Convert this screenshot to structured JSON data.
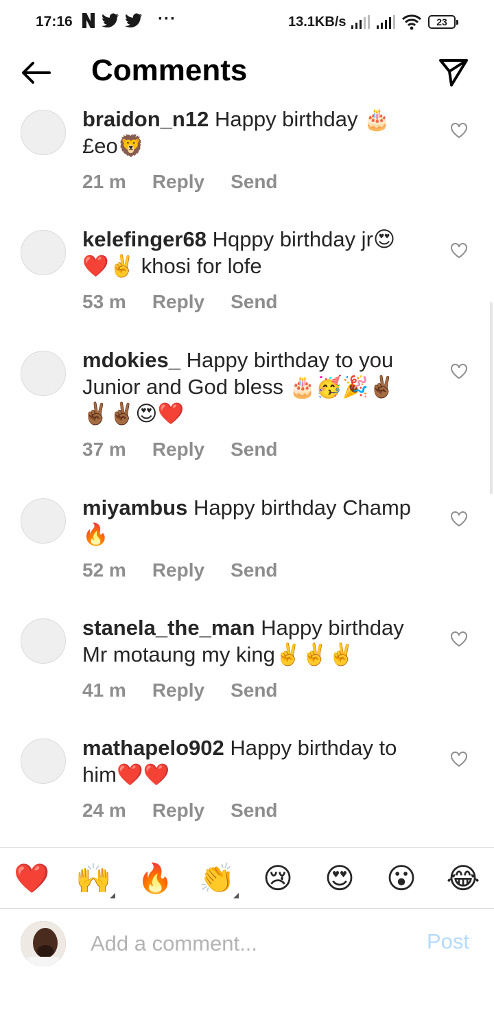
{
  "status_bar": {
    "time": "17:16",
    "more": "···",
    "net_speed": "13.1KB/s",
    "battery": "23"
  },
  "header": {
    "title": "Comments",
    "back_icon": "arrow-left-icon",
    "share_icon": "paper-plane-icon"
  },
  "comments": [
    {
      "username": "braidon_n12",
      "text": "Happy birthday 🎂 £eo🦁",
      "time": "21 m",
      "reply": "Reply",
      "send": "Send"
    },
    {
      "username": "kelefinger68",
      "text": "Hqppy birthday jr😍 ❤️✌️ khosi for lofe",
      "time": "53 m",
      "reply": "Reply",
      "send": "Send"
    },
    {
      "username": "mdokies_",
      "text": "Happy birthday to you Junior and God bless 🎂🥳🎉✌🏾 ✌🏾✌🏾😍❤️",
      "time": "37 m",
      "reply": "Reply",
      "send": "Send"
    },
    {
      "username": "miyambus",
      "text": "Happy birthday Champ 🔥",
      "time": "52 m",
      "reply": "Reply",
      "send": "Send"
    },
    {
      "username": "stanela_the_man",
      "text": "Happy birthday Mr motaung my king✌️✌️✌️",
      "time": "41 m",
      "reply": "Reply",
      "send": "Send"
    },
    {
      "username": "mathapelo902",
      "text": "Happy birthday to him❤️❤️",
      "time": "24 m",
      "reply": "Reply",
      "send": "Send"
    }
  ],
  "reactions": [
    "❤️",
    "🙌",
    "🔥",
    "👏",
    "😢",
    "😍",
    "😮",
    "😂"
  ],
  "composer": {
    "placeholder": "Add a comment...",
    "post_label": "Post"
  },
  "colors": {
    "text": "#262626",
    "muted": "#8e8e8e",
    "post_disabled": "#b3dbff",
    "avatar_placeholder": "#efefef"
  }
}
